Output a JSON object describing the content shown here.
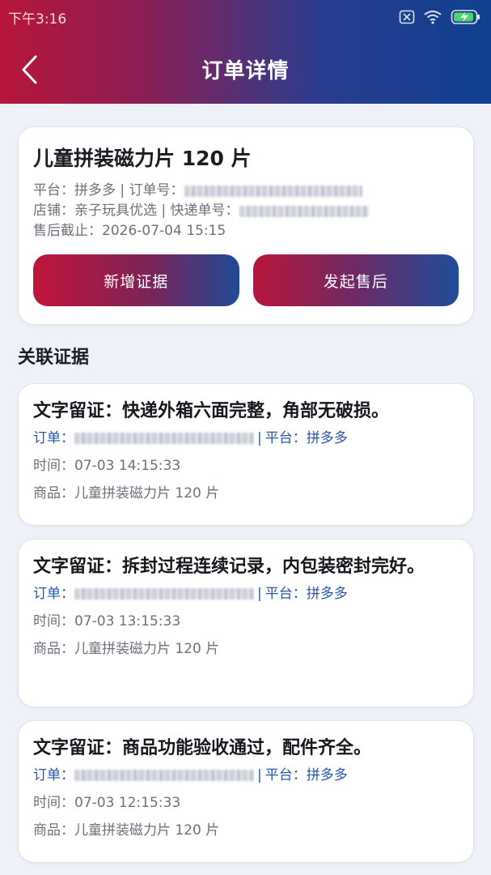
{
  "status_bar": {
    "time": "下午3:16"
  },
  "header": {
    "title": "订单详情",
    "back_icon": "chevron-left-icon"
  },
  "order": {
    "product_title": "儿童拼装磁力片 120 片",
    "platform_label": "平台：",
    "platform": "拼多多",
    "order_no_label": "订单号：",
    "shop_label": "店铺：",
    "shop": "亲子玩具优选",
    "express_label": "快递单号：",
    "deadline_label": "售后截止：",
    "deadline": "2026-07-04 15:15"
  },
  "actions": {
    "add_evidence": "新增证据",
    "start_after_sale": "发起售后"
  },
  "section": {
    "title": "关联证据"
  },
  "evidence": [
    {
      "title": "文字留证：快递外箱六面完整，角部无破损。",
      "order_label": "订单：",
      "platform_label": "平台：",
      "platform": "拼多多",
      "time_label": "时间：",
      "time": "07-03 14:15:33",
      "product_label": "商品：",
      "product": "儿童拼装磁力片 120 片"
    },
    {
      "title": "文字留证：拆封过程连续记录，内包装密封完好。",
      "order_label": "订单：",
      "platform_label": "平台：",
      "platform": "拼多多",
      "time_label": "时间：",
      "time": "07-03 13:15:33",
      "product_label": "商品：",
      "product": "儿童拼装磁力片 120 片"
    },
    {
      "title": "文字留证：商品功能验收通过，配件齐全。",
      "order_label": "订单：",
      "platform_label": "平台：",
      "platform": "拼多多",
      "time_label": "时间：",
      "time": "07-03 12:15:33",
      "product_label": "商品：",
      "product": "儿童拼装磁力片 120 片"
    }
  ]
}
